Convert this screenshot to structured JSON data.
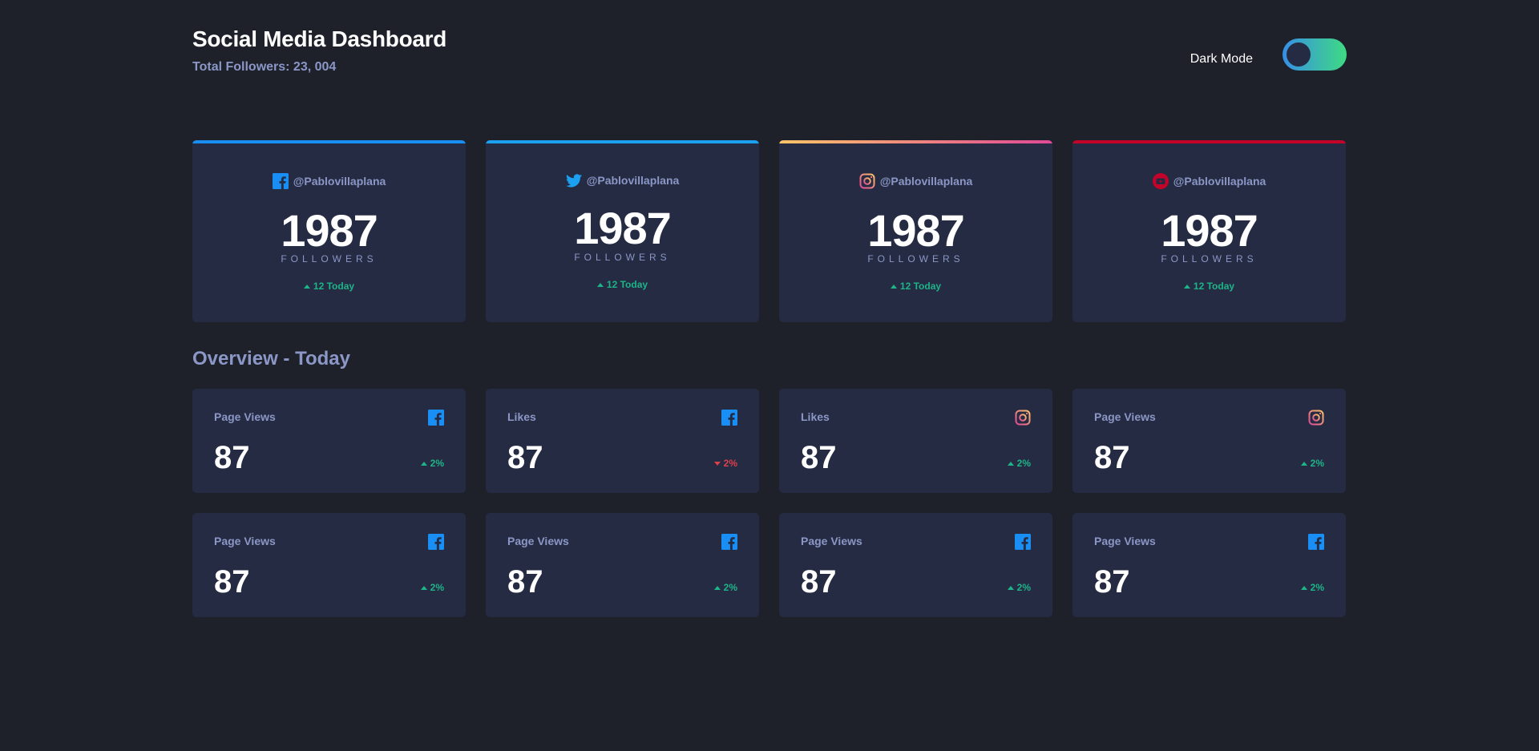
{
  "header": {
    "title": "Social Media Dashboard",
    "total_followers": "Total Followers: 23, 004",
    "mode_label": "Dark Mode"
  },
  "colors": {
    "background": "#1e202a",
    "card": "#252b42",
    "muted_text": "#8b97c6",
    "up": "#1db489",
    "down": "#dc414c",
    "facebook": "#198ff5",
    "twitter": "#1ca0f2",
    "instagram_start": "#fdc468",
    "instagram_end": "#df4996",
    "youtube": "#c4032a",
    "toggle_start": "#378fe6",
    "toggle_end": "#3eda82"
  },
  "follower_cards": [
    {
      "platform": "facebook",
      "icon": "facebook-icon",
      "handle": "@Pablovillaplana",
      "count": "1987",
      "label": "FOLLOWERS",
      "today": "12 Today",
      "trend": "up"
    },
    {
      "platform": "twitter",
      "icon": "twitter-icon",
      "handle": "@Pablovillaplana",
      "count": "1987",
      "label": "FOLLOWERS",
      "today": "12 Today",
      "trend": "up"
    },
    {
      "platform": "instagram",
      "icon": "instagram-icon",
      "handle": "@Pablovillaplana",
      "count": "1987",
      "label": "FOLLOWERS",
      "today": "12 Today",
      "trend": "up"
    },
    {
      "platform": "youtube",
      "icon": "youtube-icon",
      "handle": "@Pablovillaplana",
      "count": "1987",
      "label": "FOLLOWERS",
      "today": "12 Today",
      "trend": "up"
    }
  ],
  "overview": {
    "title": "Overview - Today",
    "cards": [
      {
        "label": "Page Views",
        "icon": "facebook-icon",
        "value": "87",
        "change": "2%",
        "trend": "up"
      },
      {
        "label": "Likes",
        "icon": "facebook-icon",
        "value": "87",
        "change": "2%",
        "trend": "down"
      },
      {
        "label": "Likes",
        "icon": "instagram-icon",
        "value": "87",
        "change": "2%",
        "trend": "up"
      },
      {
        "label": "Page Views",
        "icon": "instagram-icon",
        "value": "87",
        "change": "2%",
        "trend": "up"
      },
      {
        "label": "Page Views",
        "icon": "facebook-icon",
        "value": "87",
        "change": "2%",
        "trend": "up"
      },
      {
        "label": "Page Views",
        "icon": "facebook-icon",
        "value": "87",
        "change": "2%",
        "trend": "up"
      },
      {
        "label": "Page Views",
        "icon": "facebook-icon",
        "value": "87",
        "change": "2%",
        "trend": "up"
      },
      {
        "label": "Page Views",
        "icon": "facebook-icon",
        "value": "87",
        "change": "2%",
        "trend": "up"
      }
    ]
  }
}
